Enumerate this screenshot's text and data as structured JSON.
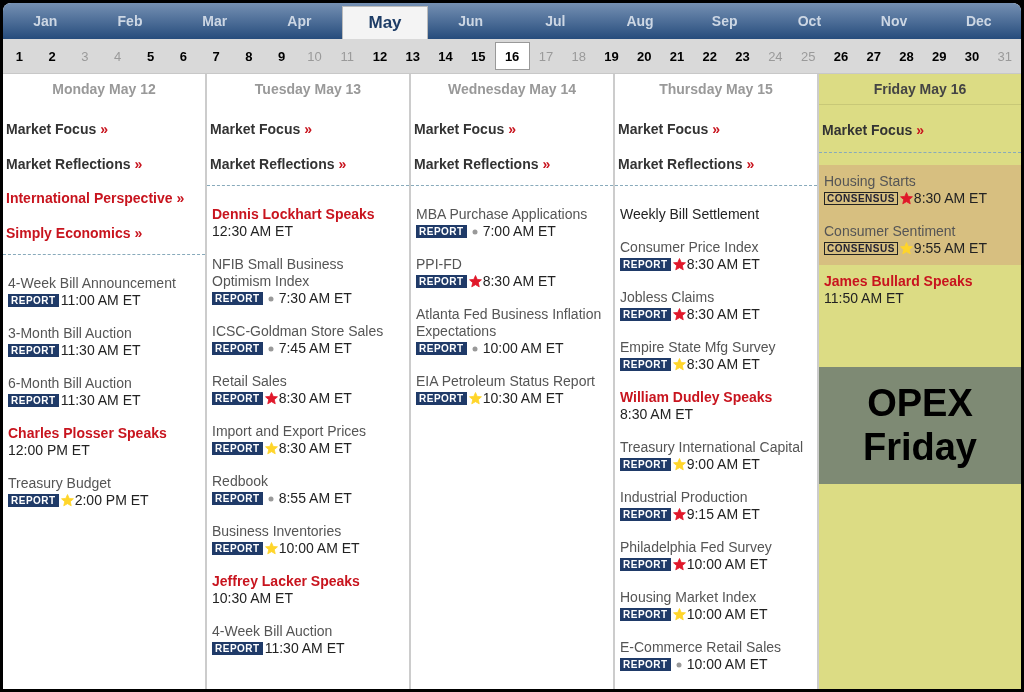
{
  "months": [
    {
      "label": "Jan",
      "selected": false
    },
    {
      "label": "Feb",
      "selected": false
    },
    {
      "label": "Mar",
      "selected": false
    },
    {
      "label": "Apr",
      "selected": false
    },
    {
      "label": "May",
      "selected": true
    },
    {
      "label": "Jun",
      "selected": false
    },
    {
      "label": "Jul",
      "selected": false
    },
    {
      "label": "Aug",
      "selected": false
    },
    {
      "label": "Sep",
      "selected": false
    },
    {
      "label": "Oct",
      "selected": false
    },
    {
      "label": "Nov",
      "selected": false
    },
    {
      "label": "Dec",
      "selected": false
    }
  ],
  "days": [
    {
      "label": "1",
      "muted": false,
      "selected": false
    },
    {
      "label": "2",
      "muted": false,
      "selected": false
    },
    {
      "label": "3",
      "muted": true,
      "selected": false
    },
    {
      "label": "4",
      "muted": true,
      "selected": false
    },
    {
      "label": "5",
      "muted": false,
      "selected": false
    },
    {
      "label": "6",
      "muted": false,
      "selected": false
    },
    {
      "label": "7",
      "muted": false,
      "selected": false
    },
    {
      "label": "8",
      "muted": false,
      "selected": false
    },
    {
      "label": "9",
      "muted": false,
      "selected": false
    },
    {
      "label": "10",
      "muted": true,
      "selected": false
    },
    {
      "label": "11",
      "muted": true,
      "selected": false
    },
    {
      "label": "12",
      "muted": false,
      "selected": false
    },
    {
      "label": "13",
      "muted": false,
      "selected": false
    },
    {
      "label": "14",
      "muted": false,
      "selected": false
    },
    {
      "label": "15",
      "muted": false,
      "selected": false
    },
    {
      "label": "16",
      "muted": false,
      "selected": true
    },
    {
      "label": "17",
      "muted": true,
      "selected": false
    },
    {
      "label": "18",
      "muted": true,
      "selected": false
    },
    {
      "label": "19",
      "muted": false,
      "selected": false
    },
    {
      "label": "20",
      "muted": false,
      "selected": false
    },
    {
      "label": "21",
      "muted": false,
      "selected": false
    },
    {
      "label": "22",
      "muted": false,
      "selected": false
    },
    {
      "label": "23",
      "muted": false,
      "selected": false
    },
    {
      "label": "24",
      "muted": true,
      "selected": false
    },
    {
      "label": "25",
      "muted": true,
      "selected": false
    },
    {
      "label": "26",
      "muted": false,
      "selected": false
    },
    {
      "label": "27",
      "muted": false,
      "selected": false
    },
    {
      "label": "28",
      "muted": false,
      "selected": false
    },
    {
      "label": "29",
      "muted": false,
      "selected": false
    },
    {
      "label": "30",
      "muted": false,
      "selected": false
    },
    {
      "label": "31",
      "muted": true,
      "selected": false
    }
  ],
  "columns": [
    {
      "heading": "Monday May 12",
      "selected": false,
      "links": [
        {
          "label": "Market Focus",
          "arrow": "»",
          "featured": false
        },
        {
          "label": "Market Reflections",
          "arrow": "»",
          "featured": false
        },
        {
          "label": "International Perspective",
          "arrow": "»",
          "featured": true
        },
        {
          "label": "Simply Economics",
          "arrow": "»",
          "featured": true
        }
      ],
      "events": [
        {
          "kind": "report",
          "title": "4-Week Bill Announcement",
          "badge": "REPORT",
          "time": "11:00 AM ET"
        },
        {
          "kind": "report",
          "title": "3-Month Bill Auction",
          "badge": "REPORT",
          "time": "11:30 AM ET"
        },
        {
          "kind": "report",
          "title": "6-Month Bill Auction",
          "badge": "REPORT",
          "time": "11:30 AM ET"
        },
        {
          "kind": "speaker",
          "title": "Charles Plosser Speaks",
          "time": "12:00 PM ET"
        },
        {
          "kind": "report",
          "title": "Treasury Budget",
          "badge": "REPORT",
          "marker": {
            "kind": "star",
            "color": "#ffd52a"
          },
          "time": "2:00 PM ET"
        }
      ]
    },
    {
      "heading": "Tuesday May 13",
      "selected": false,
      "links": [
        {
          "label": "Market Focus",
          "arrow": "»",
          "featured": false
        },
        {
          "label": "Market Reflections",
          "arrow": "»",
          "featured": false
        }
      ],
      "events": [
        {
          "kind": "speaker",
          "title": "Dennis Lockhart Speaks",
          "time": "12:30 AM ET"
        },
        {
          "kind": "report",
          "title": "NFIB Small Business Optimism Index",
          "badge": "REPORT",
          "marker": {
            "kind": "dot",
            "color": "#999999"
          },
          "time": "7:30 AM ET"
        },
        {
          "kind": "report",
          "title": "ICSC-Goldman Store Sales",
          "badge": "REPORT",
          "marker": {
            "kind": "dot",
            "color": "#999999"
          },
          "time": "7:45 AM ET"
        },
        {
          "kind": "report",
          "title": "Retail Sales",
          "badge": "REPORT",
          "marker": {
            "kind": "star",
            "color": "#e0182a"
          },
          "time": "8:30 AM ET"
        },
        {
          "kind": "report",
          "title": "Import and Export Prices",
          "badge": "REPORT",
          "marker": {
            "kind": "star",
            "color": "#ffd52a"
          },
          "time": "8:30 AM ET"
        },
        {
          "kind": "report",
          "title": "Redbook",
          "badge": "REPORT",
          "marker": {
            "kind": "dot",
            "color": "#999999"
          },
          "time": "8:55 AM ET"
        },
        {
          "kind": "report",
          "title": "Business Inventories",
          "badge": "REPORT",
          "marker": {
            "kind": "star",
            "color": "#ffd52a"
          },
          "time": "10:00 AM ET"
        },
        {
          "kind": "speaker",
          "title": "Jeffrey Lacker Speaks",
          "time": "10:30 AM ET"
        },
        {
          "kind": "report",
          "title": "4-Week Bill Auction",
          "badge": "REPORT",
          "time": "11:30 AM ET"
        }
      ]
    },
    {
      "heading": "Wednesday May 14",
      "selected": false,
      "links": [
        {
          "label": "Market Focus",
          "arrow": "»",
          "featured": false
        },
        {
          "label": "Market Reflections",
          "arrow": "»",
          "featured": false
        }
      ],
      "events": [
        {
          "kind": "report",
          "title": "MBA Purchase Applications",
          "badge": "REPORT",
          "marker": {
            "kind": "dot",
            "color": "#999999"
          },
          "time": "7:00 AM ET"
        },
        {
          "kind": "report",
          "title": "PPI-FD",
          "badge": "REPORT",
          "marker": {
            "kind": "star",
            "color": "#e0182a"
          },
          "time": "8:30 AM ET"
        },
        {
          "kind": "report",
          "title": "Atlanta Fed Business Inflation Expectations",
          "badge": "REPORT",
          "marker": {
            "kind": "dot",
            "color": "#999999"
          },
          "time": "10:00 AM ET"
        },
        {
          "kind": "report",
          "title": "EIA Petroleum Status Report",
          "badge": "REPORT",
          "marker": {
            "kind": "star",
            "color": "#ffd52a"
          },
          "time": "10:30 AM ET"
        }
      ]
    },
    {
      "heading": "Thursday May 15",
      "selected": false,
      "links": [
        {
          "label": "Market Focus",
          "arrow": "»",
          "featured": false
        },
        {
          "label": "Market Reflections",
          "arrow": "»",
          "featured": false
        }
      ],
      "events": [
        {
          "kind": "plain",
          "title": "Weekly Bill Settlement"
        },
        {
          "kind": "report",
          "title": "Consumer Price Index",
          "badge": "REPORT",
          "marker": {
            "kind": "star",
            "color": "#e0182a"
          },
          "time": "8:30 AM ET"
        },
        {
          "kind": "report",
          "title": "Jobless Claims",
          "badge": "REPORT",
          "marker": {
            "kind": "star",
            "color": "#e0182a"
          },
          "time": "8:30 AM ET"
        },
        {
          "kind": "report",
          "title": "Empire State Mfg Survey",
          "badge": "REPORT",
          "marker": {
            "kind": "star",
            "color": "#ffd52a"
          },
          "time": "8:30 AM ET"
        },
        {
          "kind": "speaker",
          "title": "William Dudley Speaks",
          "time": "8:30 AM ET"
        },
        {
          "kind": "report",
          "title": "Treasury International Capital",
          "badge": "REPORT",
          "marker": {
            "kind": "star",
            "color": "#ffd52a"
          },
          "time": "9:00 AM ET"
        },
        {
          "kind": "report",
          "title": "Industrial Production",
          "badge": "REPORT",
          "marker": {
            "kind": "star",
            "color": "#e0182a"
          },
          "time": "9:15 AM ET"
        },
        {
          "kind": "report",
          "title": "Philadelphia Fed Survey",
          "badge": "REPORT",
          "marker": {
            "kind": "star",
            "color": "#e0182a"
          },
          "time": "10:00 AM ET"
        },
        {
          "kind": "report",
          "title": "Housing Market Index",
          "badge": "REPORT",
          "marker": {
            "kind": "star",
            "color": "#ffd52a"
          },
          "time": "10:00 AM ET"
        },
        {
          "kind": "report",
          "title": "E-Commerce Retail Sales",
          "badge": "REPORT",
          "marker": {
            "kind": "dot",
            "color": "#999999"
          },
          "time": "10:00 AM ET"
        }
      ]
    },
    {
      "heading": "Friday May 16",
      "selected": true,
      "links": [
        {
          "label": "Market Focus",
          "arrow": "»",
          "featured": false
        }
      ],
      "events": [
        {
          "kind": "consensus",
          "title": "Housing Starts",
          "badge": "CONSENSUS",
          "marker": {
            "kind": "star",
            "color": "#e0182a"
          },
          "time": "8:30 AM ET"
        },
        {
          "kind": "consensus",
          "title": "Consumer Sentiment",
          "badge": "CONSENSUS",
          "marker": {
            "kind": "star",
            "color": "#ffd52a"
          },
          "time": "9:55 AM ET"
        },
        {
          "kind": "speaker",
          "title": "James Bullard Speaks",
          "time": "11:50 AM ET"
        }
      ],
      "note": "OPEX Friday"
    }
  ]
}
